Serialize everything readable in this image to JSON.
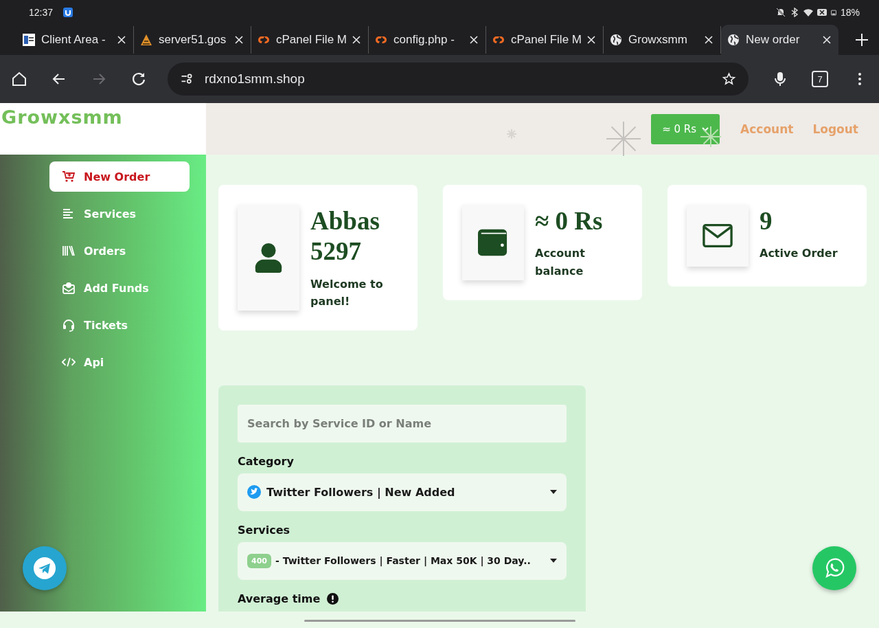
{
  "status_bar": {
    "time": "12:37",
    "battery": "18%"
  },
  "browser": {
    "tabs": [
      {
        "title": "Client Area -",
        "kind": "site",
        "selected": false
      },
      {
        "title": "server51.gos",
        "kind": "cone",
        "selected": false
      },
      {
        "title": "cPanel File M",
        "kind": "cpanel",
        "selected": false
      },
      {
        "title": "config.php -",
        "kind": "cpanel",
        "selected": false
      },
      {
        "title": "cPanel File M",
        "kind": "cpanel",
        "selected": false
      },
      {
        "title": "Growxsmm",
        "kind": "globe",
        "selected": false
      },
      {
        "title": "New order",
        "kind": "globe",
        "selected": true
      }
    ],
    "forward_disabled": true,
    "url": "rdxno1smm.shop",
    "tab_count": "7"
  },
  "site": {
    "logo": "Growxsmm",
    "balance_button": "≈ 0 Rs",
    "links": [
      "Account",
      "Logout"
    ],
    "sidebar": {
      "items": [
        {
          "label": "New Order",
          "kind": "cart",
          "selected": true
        },
        {
          "label": "Services",
          "kind": "lines",
          "selected": false
        },
        {
          "label": "Orders",
          "kind": "books",
          "selected": false
        },
        {
          "label": "Add Funds",
          "kind": "funds",
          "selected": false
        },
        {
          "label": "Tickets",
          "kind": "headset",
          "selected": false
        },
        {
          "label": "Api",
          "kind": "code",
          "selected": false
        }
      ]
    },
    "cards": [
      {
        "kind": "user",
        "value": "Abbas 5297",
        "label": "Welcome to panel!"
      },
      {
        "kind": "wallet",
        "value": "≈ 0 Rs",
        "label": "Account balance"
      },
      {
        "kind": "mail",
        "value": "9",
        "label": "Active Order"
      }
    ],
    "order_form": {
      "search": {
        "placeholder": "Search by Service ID or Name"
      },
      "category": {
        "label": "Category",
        "value": "Twitter Followers | New Added"
      },
      "services": {
        "label": "Services",
        "badge": "400",
        "value": "- Twitter Followers | Faster | Max 50K | 30 Day.."
      },
      "average_time": {
        "label": "Average time"
      }
    }
  }
}
